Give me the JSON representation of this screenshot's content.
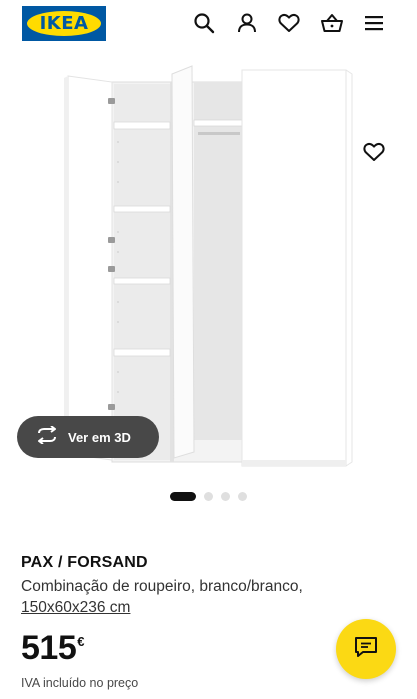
{
  "header": {
    "logo_text": "IKEA",
    "icons": [
      "search-icon",
      "user-icon",
      "heart-icon",
      "basket-icon",
      "hamburger-menu-icon"
    ]
  },
  "gallery": {
    "view_3d_label": "Ver em 3D",
    "slide_count": 4,
    "active_slide": 1
  },
  "product": {
    "name": "PAX / FORSAND",
    "description": "Combinação de roupeiro, branco/branco,",
    "dimensions": "150x60x236 cm",
    "price": "515",
    "currency": "€",
    "vat_note": "IVA incluído no preço"
  },
  "colors": {
    "ikea_blue": "#0058a3",
    "ikea_yellow": "#ffdb00",
    "chat_button": "#fbd914",
    "pill_background": "#484848"
  }
}
